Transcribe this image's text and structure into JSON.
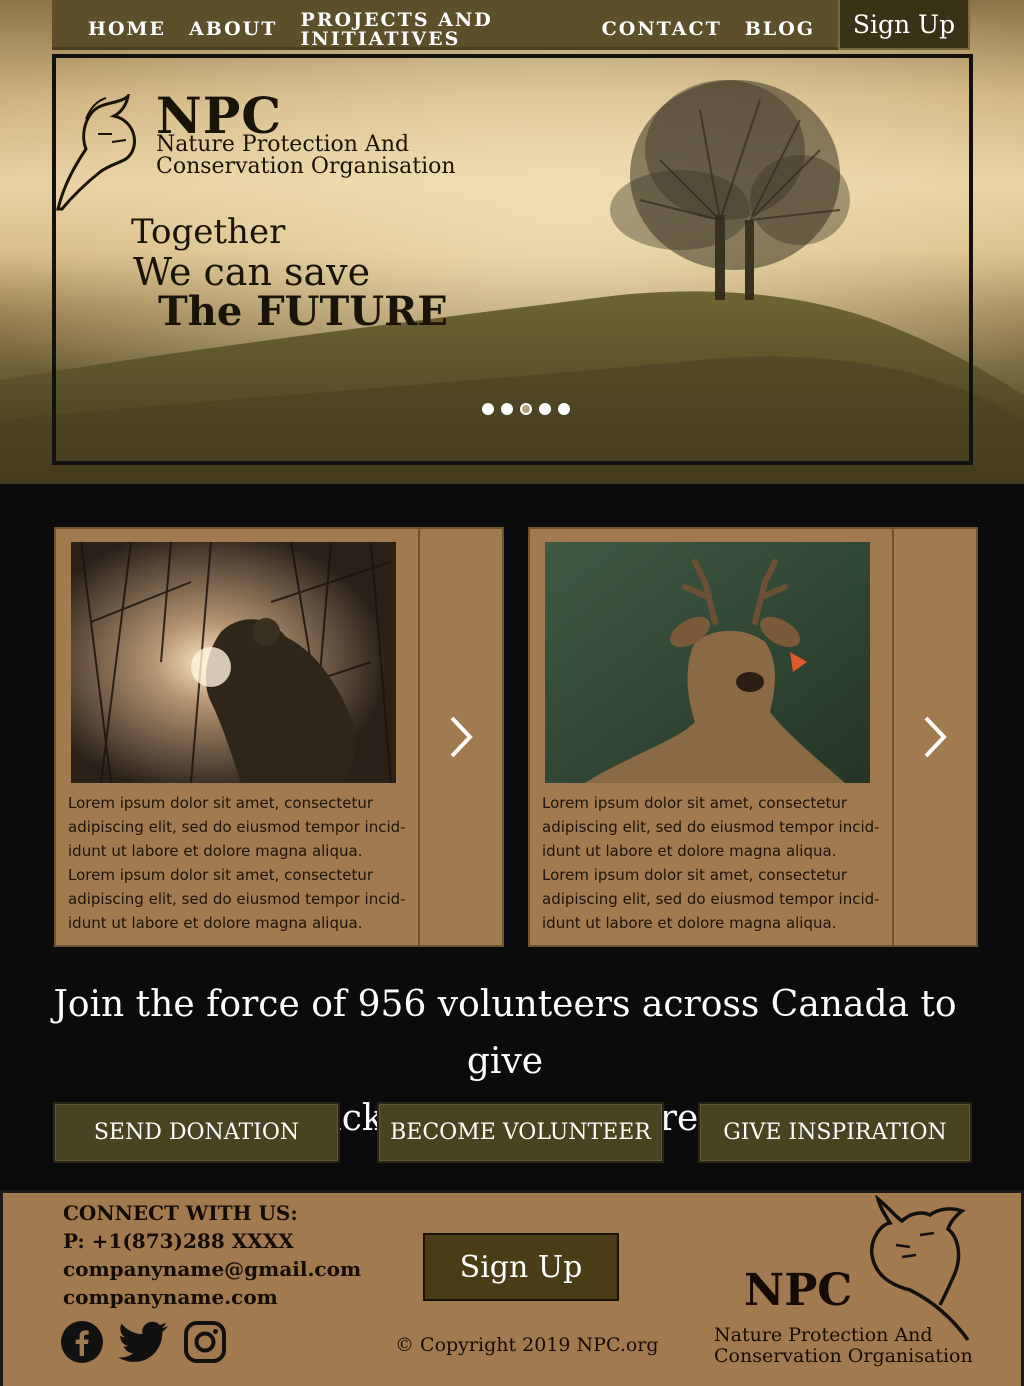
{
  "nav": {
    "items": [
      "HOME",
      "ABOUT",
      "PROJECTS AND INITIATIVES",
      "CONTACT",
      "BLOG"
    ],
    "signup": "Sign Up"
  },
  "hero": {
    "logo_title": "NPC",
    "logo_sub_1": "Nature Protection And",
    "logo_sub_2": "Conservation Organisation",
    "tagline_1": "Together",
    "tagline_2": "We can save",
    "tagline_3": "The FUTURE",
    "slides": 5,
    "active_slide": 3
  },
  "cards": [
    {
      "text": "Lorem ipsum dolor sit amet, consectetur adipiscing elit, sed do eiusmod tempor incid-idunt ut labore et dolore magna aliqua. Lorem ipsum dolor sit amet, consectetur adipiscing elit, sed do eiusmod tempor incid-idunt ut labore et dolore magna aliqua.",
      "lines": [
        "Lorem ipsum dolor sit amet, consectetur",
        "adipiscing elit, sed do eiusmod tempor incid-",
        "idunt ut labore et dolore magna aliqua.",
        "Lorem ipsum dolor sit amet, consectetur",
        "adipiscing elit, sed do eiusmod tempor incid-",
        "idunt ut labore et dolore magna aliqua."
      ]
    },
    {
      "lines": [
        "Lorem ipsum dolor sit amet, consectetur",
        "adipiscing elit, sed do eiusmod tempor incid-",
        "idunt ut labore et dolore magna aliqua.",
        "Lorem ipsum dolor sit amet, consectetur",
        "adipiscing elit, sed do eiusmod tempor incid-",
        "idunt ut labore et dolore magna aliqua."
      ]
    }
  ],
  "cta": {
    "line_1": "Join the force of 956 volunteers across Canada to give",
    "line_2": "back to Mothernature!",
    "buttons": [
      "SEND DONATION",
      "BECOME VOLUNTEER",
      "GIVE INSPIRATION"
    ]
  },
  "footer": {
    "connect_title": "CONNECT WITH US:",
    "phone": "P: +1(873)288 XXXX",
    "email": "companyname@gmail.com",
    "website": "companyname.com",
    "signup": "Sign Up",
    "copyright": "Copyright 2019 NPC.org",
    "logo_title": "NPC",
    "logo_sub_1": "Nature Protection And",
    "logo_sub_2": "Conservation Organisation",
    "social": [
      "facebook-icon",
      "twitter-icon",
      "instagram-icon"
    ]
  },
  "colors": {
    "nav_bg": "#5e4f2c",
    "card_bg": "#a27a4f",
    "button_bg": "#4a4322",
    "page_bg": "#0b0b0b"
  }
}
